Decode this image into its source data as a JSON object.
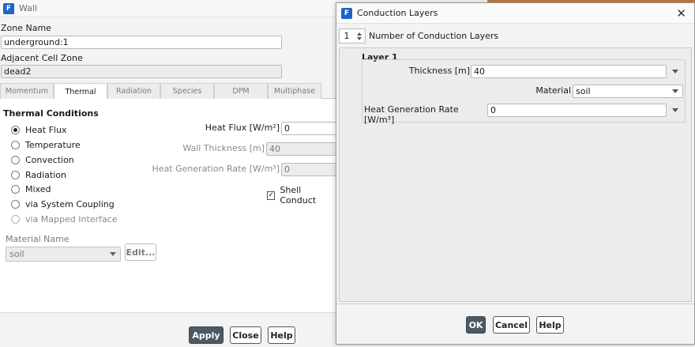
{
  "wall": {
    "title": "Wall",
    "zone_name_label": "Zone Name",
    "zone_name_value": "underground:1",
    "adjacent_cell_zone_label": "Adjacent Cell Zone",
    "adjacent_cell_zone_value": "dead2",
    "tabs": [
      {
        "label": "Momentum",
        "active": false
      },
      {
        "label": "Thermal",
        "active": true
      },
      {
        "label": "Radiation",
        "active": false
      },
      {
        "label": "Species",
        "active": false
      },
      {
        "label": "DPM",
        "active": false
      },
      {
        "label": "Multiphase",
        "active": false
      }
    ],
    "thermal_conditions_title": "Thermal Conditions",
    "radio_options": [
      {
        "label": "Heat Flux",
        "selected": true,
        "enabled": true
      },
      {
        "label": "Temperature",
        "selected": false,
        "enabled": true
      },
      {
        "label": "Convection",
        "selected": false,
        "enabled": true
      },
      {
        "label": "Radiation",
        "selected": false,
        "enabled": true
      },
      {
        "label": "Mixed",
        "selected": false,
        "enabled": true
      },
      {
        "label": "via System Coupling",
        "selected": false,
        "enabled": true
      },
      {
        "label": "via Mapped Interface",
        "selected": false,
        "enabled": false
      }
    ],
    "heat_flux_label": "Heat Flux [W/m²]",
    "heat_flux_value": "0",
    "wall_thickness_label": "Wall Thickness [m]",
    "wall_thickness_value": "40",
    "heat_generation_label": "Heat Generation Rate [W/m³]",
    "heat_generation_value": "0",
    "shell_conduction_label": "Shell Conduct",
    "shell_conduction_checked": true,
    "material_name_label": "Material Name",
    "material_name_value": "soil",
    "edit_button": "Edit...",
    "apply_button": "Apply",
    "close_button": "Close",
    "help_button": "Help"
  },
  "dialog": {
    "title": "Conduction Layers",
    "num_layers_value": "1",
    "num_layers_label": "Number of Conduction Layers",
    "layer_title": "Layer  1",
    "thickness_label": "Thickness [m]",
    "thickness_value": "40",
    "material_label": "Material",
    "material_value": "soil",
    "heat_gen_label": "Heat Generation Rate [W/m³]",
    "heat_gen_value": "0",
    "ok_button": "OK",
    "cancel_button": "Cancel",
    "help_button": "Help",
    "close_glyph": "✕"
  },
  "colors": {
    "accent": "#1f63c4",
    "primary_button": "#4c5a66",
    "title_strip": "#c87b3a"
  }
}
